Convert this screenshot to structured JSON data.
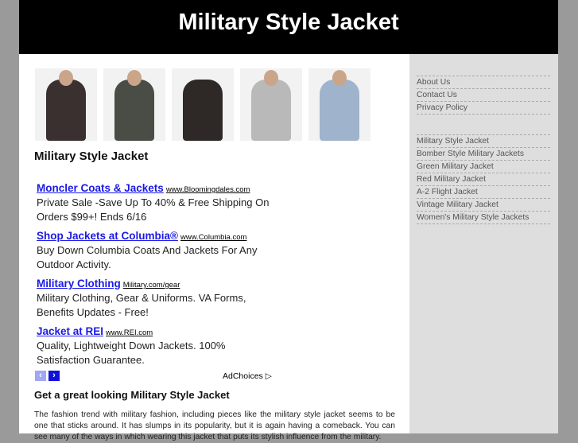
{
  "header": {
    "title": "Military Style Jacket"
  },
  "main": {
    "heading": "Military Style Jacket",
    "ads": [
      {
        "title": "Moncler Coats & Jackets",
        "url": "www.Bloomingdales.com",
        "desc": "Private Sale -Save Up To 40% & Free Shipping On Orders $99+! Ends 6/16"
      },
      {
        "title": "Shop Jackets at Columbia®",
        "url": "www.Columbia.com",
        "desc": "Buy Down Columbia Coats And Jackets For Any Outdoor Activity."
      },
      {
        "title": "Military Clothing",
        "url": "Military.com/gear",
        "desc": "Military Clothing, Gear & Uniforms. VA Forms, Benefits Updates - Free!"
      },
      {
        "title": "Jacket at REI",
        "url": "www.REI.com",
        "desc": "Quality, Lightweight Down Jackets. 100% Satisfaction Guarantee."
      }
    ],
    "adchoices": "AdChoices",
    "subheading": "Get a great looking Military Style Jacket",
    "paragraph": "The fashion trend with military fashion, including pieces like the military style jacket seems to be one that sticks around. It has slumps in its popularity, but it is again having a comeback. You can see many of the ways in which wearing this jacket that puts its stylish influence from the military."
  },
  "sidebar": {
    "pages": [
      "About Us",
      "Contact Us",
      "Privacy Policy"
    ],
    "links": [
      "Military Style Jacket",
      "Bomber Style Military Jackets",
      "Green Military Jacket",
      "Red Military Jacket",
      "A-2 Flight Jacket",
      "Vintage Military Jacket",
      "Women's Military Style Jackets"
    ]
  },
  "colors": {
    "coats": [
      "#3a3030",
      "#4a4d45",
      "#2e2826",
      "#b9b9b9",
      "#9fb4cc"
    ]
  }
}
